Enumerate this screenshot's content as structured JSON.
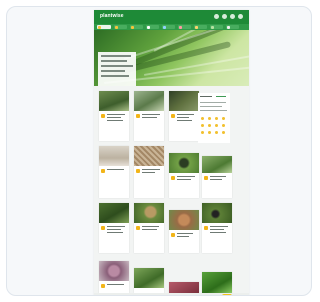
{
  "page": {
    "logo_text": "plantwise",
    "colors": {
      "brand_green": "#1e8a37",
      "accent_yellow": "#f2b519",
      "card_bg": "#ffffff",
      "page_bg": "#f2f4f3"
    }
  },
  "header": {
    "icons": [
      "search-icon",
      "user-icon",
      "globe-icon",
      "menu-icon"
    ]
  },
  "nav": {
    "item_count": 9
  },
  "cards": {
    "count": 15
  }
}
